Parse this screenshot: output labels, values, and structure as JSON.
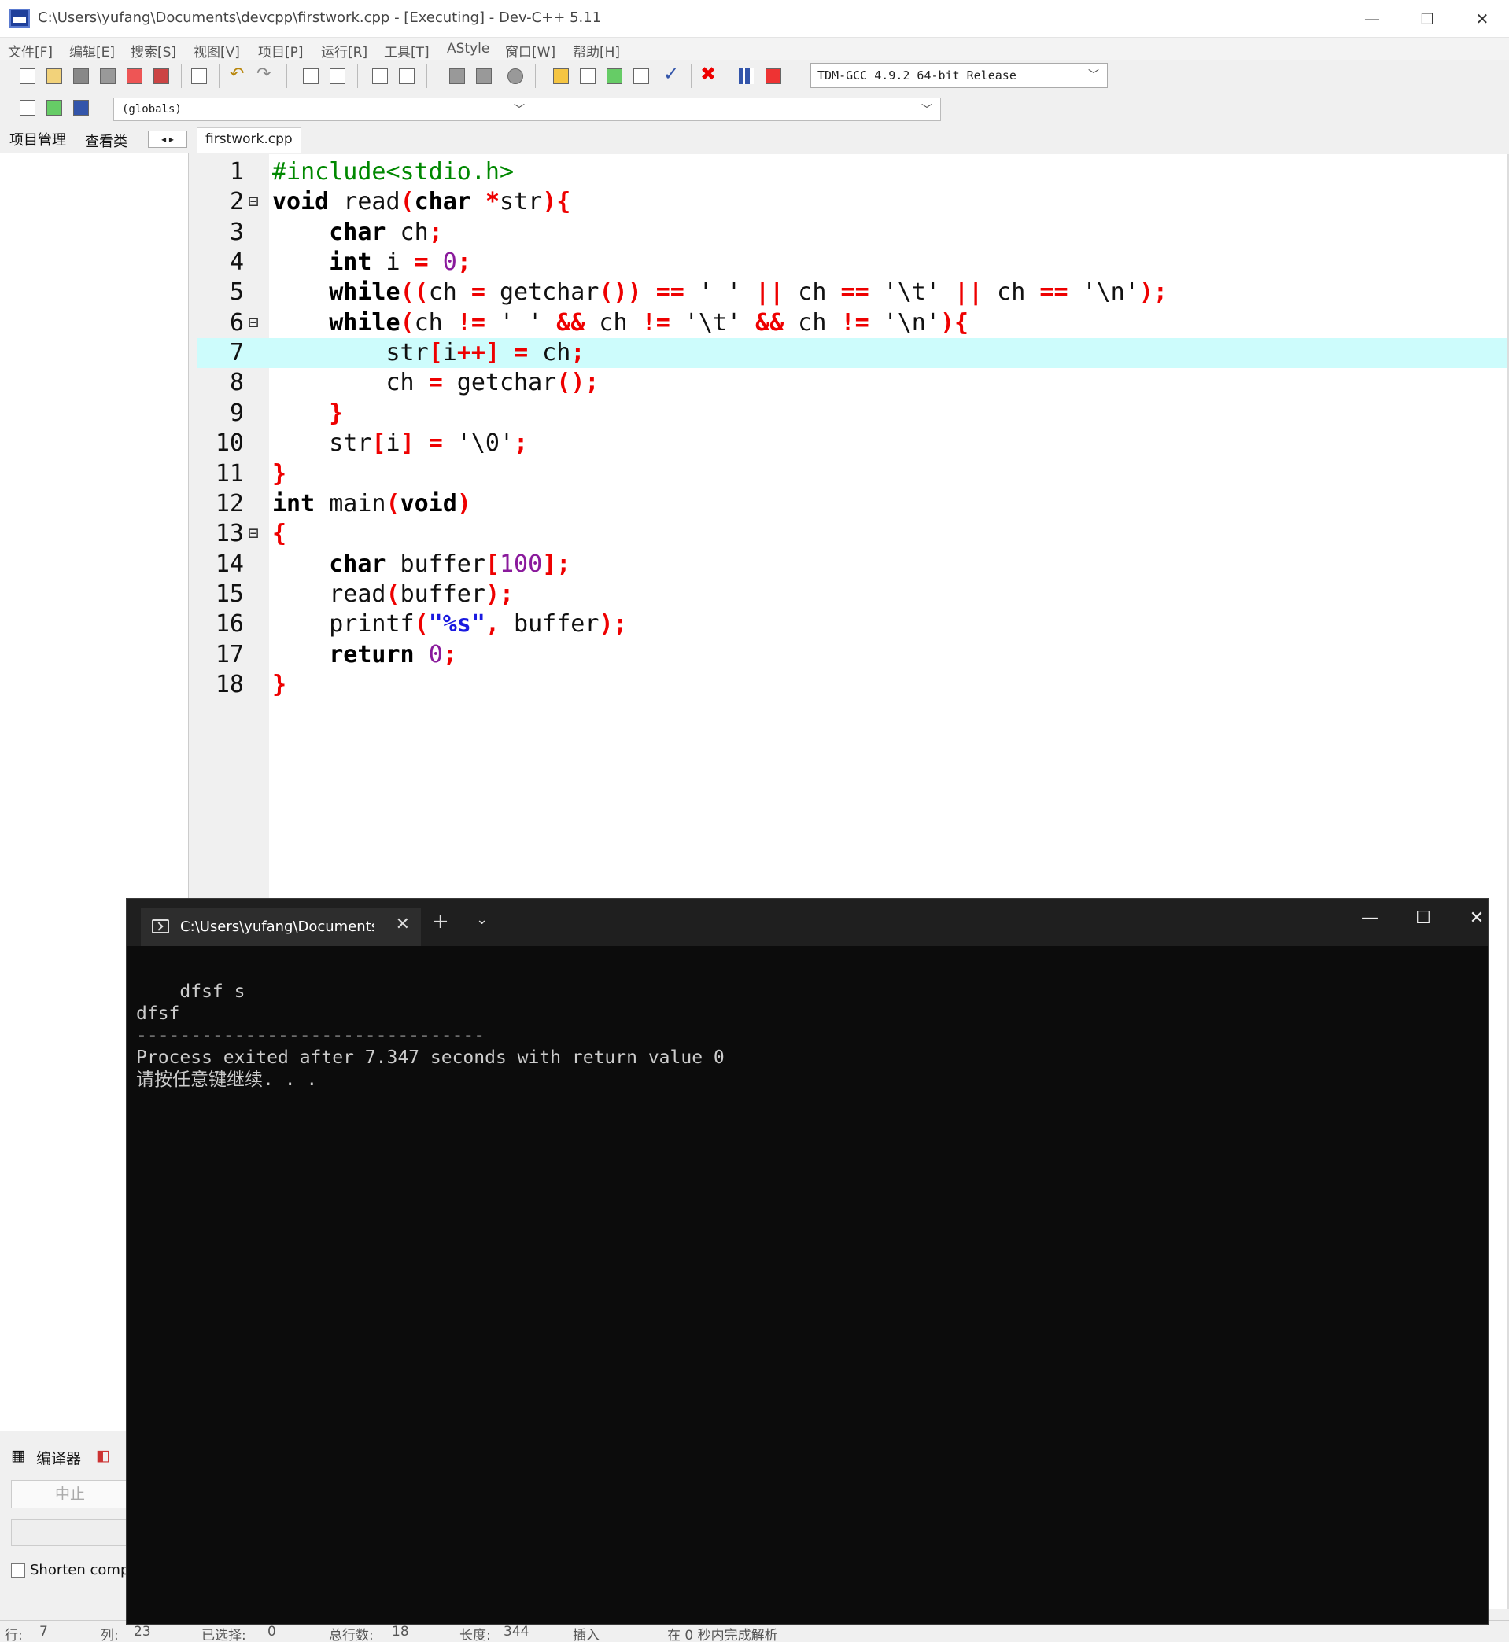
{
  "window": {
    "title": "C:\\Users\\yufang\\Documents\\devcpp\\firstwork.cpp - [Executing] - Dev-C++ 5.11",
    "minimize": "—",
    "maximize": "☐",
    "close": "✕"
  },
  "menu": [
    "文件[F]",
    "编辑[E]",
    "搜索[S]",
    "视图[V]",
    "项目[P]",
    "运行[R]",
    "工具[T]",
    "AStyle",
    "窗口[W]",
    "帮助[H]"
  ],
  "toolbar": {
    "compiler": "TDM-GCC 4.9.2 64-bit Release",
    "scope": "(globals)",
    "function": ""
  },
  "left_tabs": [
    "项目管理",
    "查看类"
  ],
  "nav_arrows": "◂ ▸",
  "editor": {
    "file_tab": "firstwork.cpp",
    "lines": [
      {
        "n": "1",
        "fold": "",
        "text": "#include<stdio.h>"
      },
      {
        "n": "2",
        "fold": "⊟",
        "text": "void read(char *str){"
      },
      {
        "n": "3",
        "fold": "",
        "text": "    char ch;"
      },
      {
        "n": "4",
        "fold": "",
        "text": "    int i = 0;"
      },
      {
        "n": "5",
        "fold": "",
        "text": "    while((ch = getchar()) == ' ' || ch == '\\t' || ch == '\\n');"
      },
      {
        "n": "6",
        "fold": "⊟",
        "text": "    while(ch != ' ' && ch != '\\t' && ch != '\\n'){"
      },
      {
        "n": "7",
        "fold": "",
        "text": "        str[i++] = ch;"
      },
      {
        "n": "8",
        "fold": "",
        "text": "        ch = getchar();"
      },
      {
        "n": "9",
        "fold": "",
        "text": "    }"
      },
      {
        "n": "10",
        "fold": "",
        "text": "    str[i] = '\\0';"
      },
      {
        "n": "11",
        "fold": "",
        "text": "}"
      },
      {
        "n": "12",
        "fold": "",
        "text": "int main(void)"
      },
      {
        "n": "13",
        "fold": "⊟",
        "text": "{"
      },
      {
        "n": "14",
        "fold": "",
        "text": "    char buffer[100];"
      },
      {
        "n": "15",
        "fold": "",
        "text": "    read(buffer);"
      },
      {
        "n": "16",
        "fold": "",
        "text": "    printf(\"%s\", buffer);"
      },
      {
        "n": "17",
        "fold": "",
        "text": "    return 0;"
      },
      {
        "n": "18",
        "fold": "",
        "text": "}"
      }
    ],
    "highlighted_line": 7
  },
  "bottom_panel": {
    "compiler_tab": "编译器",
    "abort_button": "中止",
    "shorten_label": "Shorten compil"
  },
  "status": {
    "row_label": "行:",
    "row": "7",
    "col_label": "列:",
    "col": "23",
    "sel_label": "已选择:",
    "sel": "0",
    "lines_label": "总行数:",
    "lines": "18",
    "len_label": "长度:",
    "len": "344",
    "mode": "插入",
    "parse": "在 0 秒内完成解析"
  },
  "console": {
    "tab_title": "C:\\Users\\yufang\\Documents\\c",
    "output": "\n    dfsf s\ndfsf\n--------------------------------\nProcess exited after 7.347 seconds with return value 0\n请按任意键继续. . ."
  },
  "colors": {
    "keyword": "#000000",
    "preprocessor": "#008800",
    "symbol": "#ee0000",
    "number": "#8a1a9c",
    "string": "#1a1ae0",
    "highlight": "#cdfcfc",
    "console_bg": "#0c0c0c"
  }
}
